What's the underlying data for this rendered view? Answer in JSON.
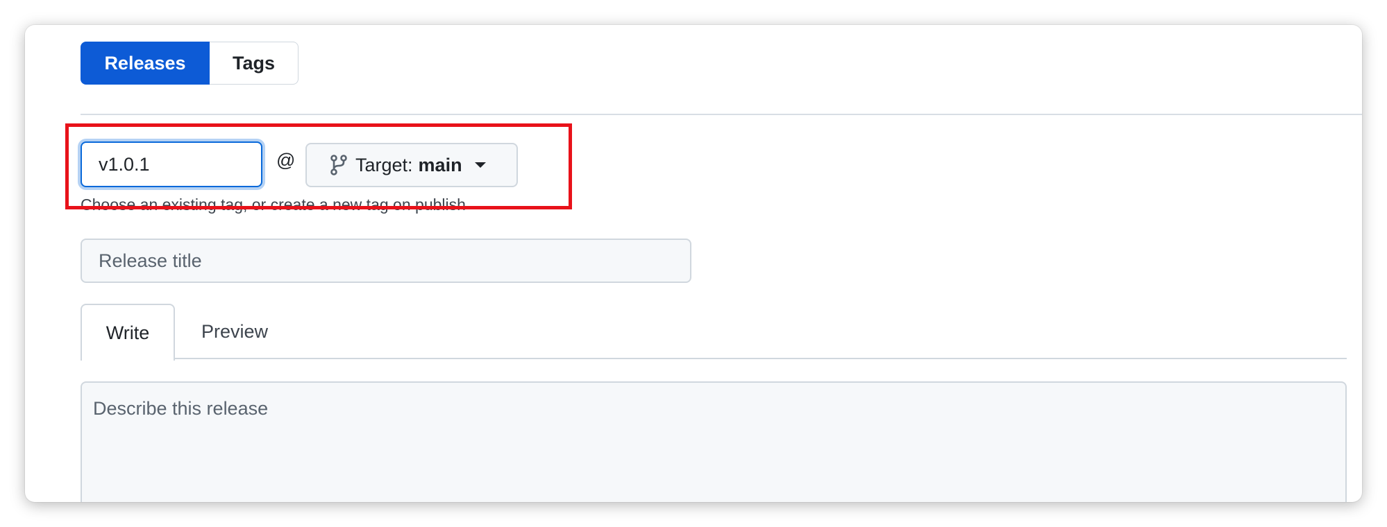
{
  "tabs_segmented": {
    "releases_label": "Releases",
    "tags_label": "Tags",
    "selected": "Releases"
  },
  "tag_selector": {
    "tag_value": "v1.0.1",
    "at_symbol": "@",
    "target_prefix": "Target:",
    "target_branch": "main",
    "helper_text": "Choose an existing tag, or create a new tag on publish"
  },
  "release_title": {
    "placeholder": "Release title"
  },
  "editor_tabs": {
    "write_label": "Write",
    "preview_label": "Preview",
    "selected": "Write"
  },
  "description": {
    "placeholder": "Describe this release"
  },
  "icons": {
    "branch": "git-branch-icon",
    "caret": "caret-down-icon"
  },
  "colors": {
    "primary": "#0d5bd6",
    "focus_ring": "#0969da",
    "highlight_annotation": "#e8121a"
  }
}
